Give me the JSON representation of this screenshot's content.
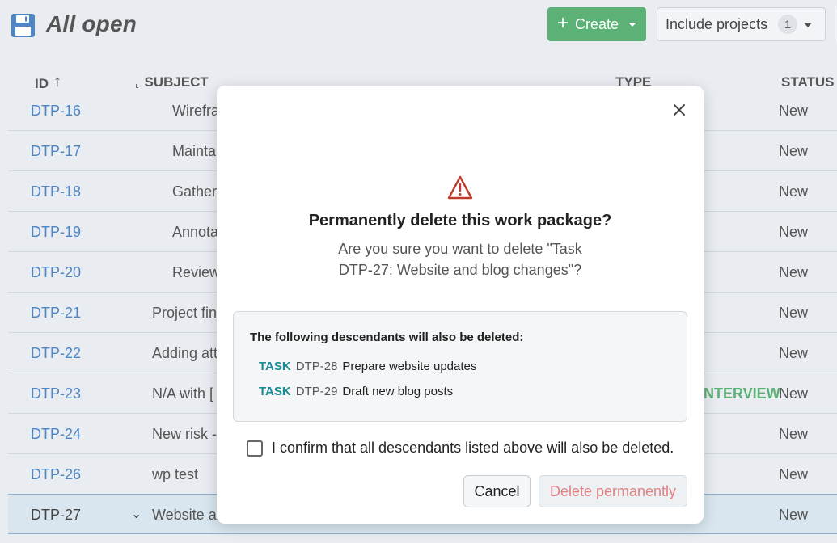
{
  "header": {
    "title": "All open",
    "create_label": "Create",
    "include_projects_label": "Include projects",
    "include_projects_count": "1"
  },
  "table": {
    "columns": {
      "id": "ID",
      "subject": "SUBJECT",
      "type": "TYPE",
      "status": "STATUS"
    },
    "rows": [
      {
        "id": "DTP-16",
        "subject": "Wirefra",
        "status": "New"
      },
      {
        "id": "DTP-17",
        "subject": "Mainta",
        "status": "New"
      },
      {
        "id": "DTP-18",
        "subject": "Gather",
        "status": "New"
      },
      {
        "id": "DTP-19",
        "subject": "Annota",
        "status": "New"
      },
      {
        "id": "DTP-20",
        "subject": "Review",
        "status": "New"
      },
      {
        "id": "DTP-21",
        "subject": "Project fin",
        "status": "New"
      },
      {
        "id": "DTP-22",
        "subject": "Adding att",
        "status": "New"
      },
      {
        "id": "DTP-23",
        "subject": "N/A with [",
        "type_fragment": "NTERVIEW",
        "status": "New"
      },
      {
        "id": "DTP-24",
        "subject": "New risk -",
        "status": "New"
      },
      {
        "id": "DTP-26",
        "subject": "wp test",
        "status": "New"
      },
      {
        "id": "DTP-27",
        "subject": "Website ar",
        "status": "New"
      }
    ]
  },
  "modal": {
    "title": "Permanently delete this work package?",
    "body": "Are you sure you want to delete \"Task DTP-27: Website and blog changes\"?",
    "descendants_heading": "The following descendants will also be deleted:",
    "descendants": [
      {
        "type": "TASK",
        "id": "DTP-28",
        "name": "Prepare website updates"
      },
      {
        "type": "TASK",
        "id": "DTP-29",
        "name": "Draft new blog posts"
      }
    ],
    "confirm_label": "I confirm that all descendants listed above will also be deleted.",
    "cancel_label": "Cancel",
    "delete_label": "Delete permanently"
  },
  "colors": {
    "accent_green": "#5cb176",
    "link_blue": "#4f86c6",
    "task_teal": "#1a8c95",
    "danger_red": "#c0392b"
  },
  "icons": [
    "save-icon",
    "plus-icon",
    "chevron-down-icon",
    "sort-up-icon",
    "hierarchy-icon",
    "close-icon",
    "warning-icon",
    "checkbox-icon"
  ]
}
